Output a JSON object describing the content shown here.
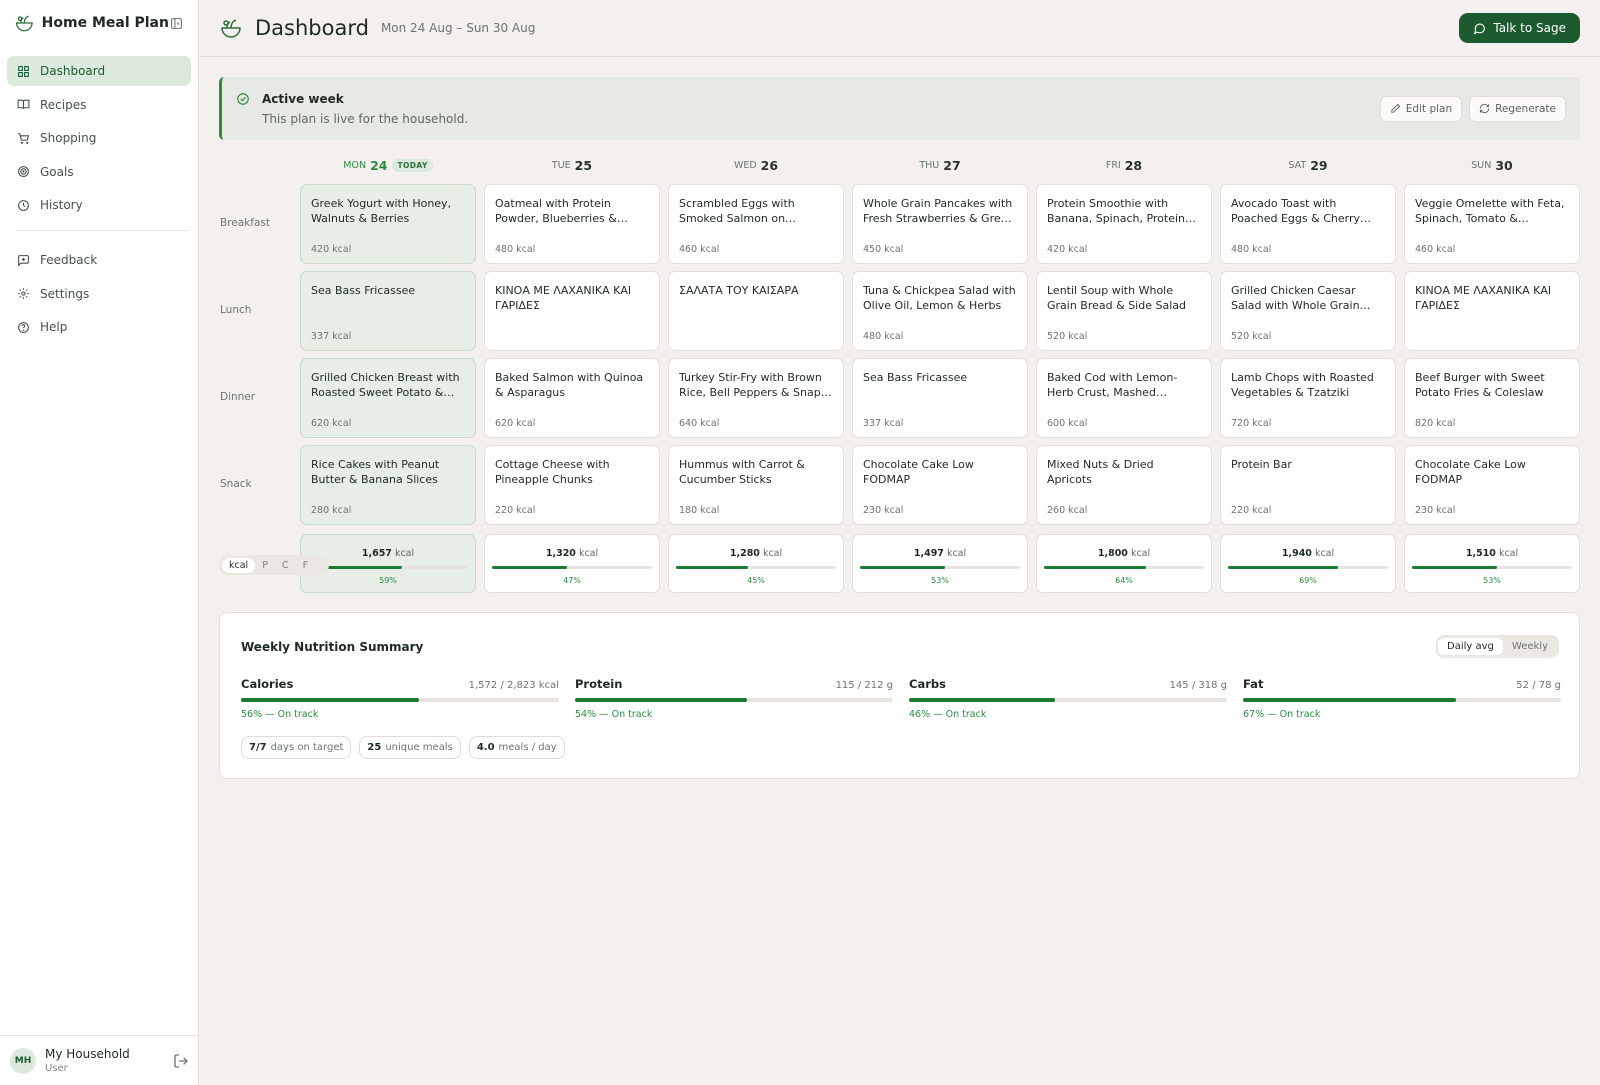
{
  "app": {
    "title": "Home Meal Plan"
  },
  "sidebar": {
    "items": [
      {
        "label": "Dashboard",
        "icon": "grid-icon"
      },
      {
        "label": "Recipes",
        "icon": "book-icon"
      },
      {
        "label": "Shopping",
        "icon": "cart-icon"
      },
      {
        "label": "Goals",
        "icon": "target-icon"
      },
      {
        "label": "History",
        "icon": "clock-icon"
      },
      {
        "label": "Feedback",
        "icon": "message-plus-icon"
      },
      {
        "label": "Settings",
        "icon": "gear-icon"
      },
      {
        "label": "Help",
        "icon": "help-circle-icon"
      }
    ],
    "user": {
      "initials": "MH",
      "name": "My Household",
      "role": "User"
    }
  },
  "header": {
    "title": "Dashboard",
    "date_range": "Mon 24 Aug – Sun 30 Aug",
    "talk_label": "Talk to Sage"
  },
  "banner": {
    "title": "Active week",
    "subtitle": "This plan is live for the household.",
    "edit_label": "Edit plan",
    "regen_label": "Regenerate"
  },
  "days": [
    {
      "name": "MON",
      "num": "24",
      "today": "TODAY"
    },
    {
      "name": "TUE",
      "num": "25"
    },
    {
      "name": "WED",
      "num": "26"
    },
    {
      "name": "THU",
      "num": "27"
    },
    {
      "name": "FRI",
      "num": "28"
    },
    {
      "name": "SAT",
      "num": "29"
    },
    {
      "name": "SUN",
      "num": "30"
    }
  ],
  "rows": [
    {
      "label": "Breakfast",
      "meals": [
        {
          "name": "Greek Yogurt with Honey, Walnuts & Berries",
          "kcal": "420 kcal"
        },
        {
          "name": "Oatmeal with Protein Powder, Blueberries & Almond Butter",
          "kcal": "480 kcal"
        },
        {
          "name": "Scrambled Eggs with Smoked Salmon on Wholegrain Toast",
          "kcal": "460 kcal"
        },
        {
          "name": "Whole Grain Pancakes with Fresh Strawberries & Greek Yogurt",
          "kcal": "450 kcal"
        },
        {
          "name": "Protein Smoothie with Banana, Spinach, Protein Powder",
          "kcal": "420 kcal"
        },
        {
          "name": "Avocado Toast with Poached Eggs & Cherry Tomatoes on Rye",
          "kcal": "480 kcal"
        },
        {
          "name": "Veggie Omelette with Feta, Spinach, Tomato & Wholegrain Toast",
          "kcal": "460 kcal"
        }
      ]
    },
    {
      "label": "Lunch",
      "meals": [
        {
          "name": "Sea Bass Fricassee",
          "kcal": "337 kcal"
        },
        {
          "name": "ΚΙΝΟΑ ΜΕ ΛΑΧΑΝΙΚΑ ΚΑΙ ΓΑΡΙΔΕΣ",
          "kcal": ""
        },
        {
          "name": "ΣΑΛΑΤΑ ΤΟΥ ΚΑΙΣΑΡΑ",
          "kcal": ""
        },
        {
          "name": "Tuna & Chickpea Salad with Olive Oil, Lemon & Herbs",
          "kcal": "480 kcal"
        },
        {
          "name": "Lentil Soup with Whole Grain Bread & Side Salad",
          "kcal": "520 kcal"
        },
        {
          "name": "Grilled Chicken Caesar Salad with Whole Grain Croutons",
          "kcal": "520 kcal"
        },
        {
          "name": "ΚΙΝΟΑ ΜΕ ΛΑΧΑΝΙΚΑ ΚΑΙ ΓΑΡΙΔΕΣ",
          "kcal": ""
        }
      ]
    },
    {
      "label": "Dinner",
      "meals": [
        {
          "name": "Grilled Chicken Breast with Roasted Sweet Potato & Broccoli",
          "kcal": "620 kcal"
        },
        {
          "name": "Baked Salmon with Quinoa & Asparagus",
          "kcal": "620 kcal"
        },
        {
          "name": "Turkey Stir-Fry with Brown Rice, Bell Peppers & Snap Peas",
          "kcal": "640 kcal"
        },
        {
          "name": "Sea Bass Fricassee",
          "kcal": "337 kcal"
        },
        {
          "name": "Baked Cod with Lemon-Herb Crust, Mashed Potatoes & Green Beans",
          "kcal": "600 kcal"
        },
        {
          "name": "Lamb Chops with Roasted Vegetables & Tzatziki",
          "kcal": "720 kcal"
        },
        {
          "name": "Beef Burger with Sweet Potato Fries & Coleslaw",
          "kcal": "820 kcal"
        }
      ]
    },
    {
      "label": "Snack",
      "meals": [
        {
          "name": "Rice Cakes with Peanut Butter & Banana Slices",
          "kcal": "280 kcal"
        },
        {
          "name": "Cottage Cheese with Pineapple Chunks",
          "kcal": "220 kcal"
        },
        {
          "name": "Hummus with Carrot & Cucumber Sticks",
          "kcal": "180 kcal"
        },
        {
          "name": "Chocolate Cake Low FODMAP",
          "kcal": "230 kcal"
        },
        {
          "name": "Mixed Nuts & Dried Apricots",
          "kcal": "260 kcal"
        },
        {
          "name": "Protein Bar",
          "kcal": "220 kcal"
        },
        {
          "name": "Chocolate Cake Low FODMAP",
          "kcal": "230 kcal"
        }
      ]
    }
  ],
  "macro_toggle": [
    "kcal",
    "P",
    "C",
    "F"
  ],
  "totals": [
    {
      "value": "1,657",
      "unit": "kcal",
      "pct": "59%",
      "fraction": 0.59
    },
    {
      "value": "1,320",
      "unit": "kcal",
      "pct": "47%",
      "fraction": 0.47
    },
    {
      "value": "1,280",
      "unit": "kcal",
      "pct": "45%",
      "fraction": 0.45
    },
    {
      "value": "1,497",
      "unit": "kcal",
      "pct": "53%",
      "fraction": 0.53
    },
    {
      "value": "1,800",
      "unit": "kcal",
      "pct": "64%",
      "fraction": 0.64
    },
    {
      "value": "1,940",
      "unit": "kcal",
      "pct": "69%",
      "fraction": 0.69
    },
    {
      "value": "1,510",
      "unit": "kcal",
      "pct": "53%",
      "fraction": 0.53
    }
  ],
  "summary": {
    "title": "Weekly Nutrition Summary",
    "toggle": [
      "Daily avg",
      "Weekly"
    ],
    "macros": [
      {
        "name": "Calories",
        "value": "1,572 / 2,823 kcal",
        "status": "56% — On track",
        "fraction": 0.56
      },
      {
        "name": "Protein",
        "value": "115 / 212 g",
        "status": "54% — On track",
        "fraction": 0.54
      },
      {
        "name": "Carbs",
        "value": "145 / 318 g",
        "status": "46% — On track",
        "fraction": 0.46
      },
      {
        "name": "Fat",
        "value": "52 / 78 g",
        "status": "67% — On track",
        "fraction": 0.67
      }
    ],
    "chips": [
      {
        "value": "7/7",
        "label": "days on target"
      },
      {
        "value": "25",
        "label": "unique meals"
      },
      {
        "value": "4.0",
        "label": "meals / day"
      }
    ]
  },
  "colors": {
    "accent": "#1d5a2f",
    "bar": "#1d7a33",
    "today_bg": "#e7eee6"
  }
}
